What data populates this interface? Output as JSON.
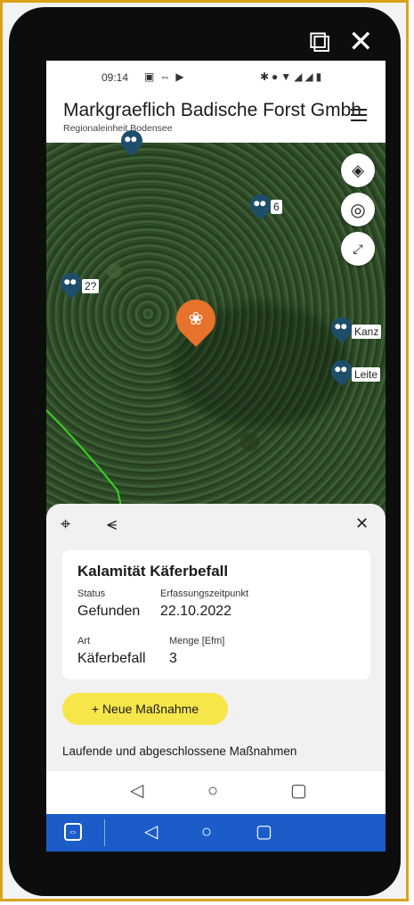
{
  "window_controls": {
    "popout_icon": "popout-icon",
    "close_icon": "close-icon"
  },
  "status_bar": {
    "time": "09:14"
  },
  "header": {
    "title": "Markgraeflich Badische Forst Gmbh",
    "subtitle": "Regionaleinheit Bodensee"
  },
  "map": {
    "markers": [
      {
        "label": "6"
      },
      {
        "label": "2?"
      },
      {
        "label": "Kanz"
      },
      {
        "label": "Leite"
      }
    ],
    "controls": [
      "layers-icon",
      "locate-icon",
      "fullscreen-icon"
    ]
  },
  "detail": {
    "title": "Kalamität Käferbefall",
    "status_label": "Status",
    "status_value": "Gefunden",
    "time_label": "Erfassungszeitpunkt",
    "time_value": "22.10.2022",
    "type_label": "Art",
    "type_value": "Käferbefall",
    "amount_label": "Menge [Efm]",
    "amount_value": "3",
    "add_button": "+ Neue Maßnahme",
    "section": "Laufende und abgeschlossene Maßnahmen"
  },
  "colors": {
    "accent": "#e6722b",
    "button": "#f7e64a",
    "remote_bar": "#1b5cc9",
    "frame": "#d9a21a"
  }
}
